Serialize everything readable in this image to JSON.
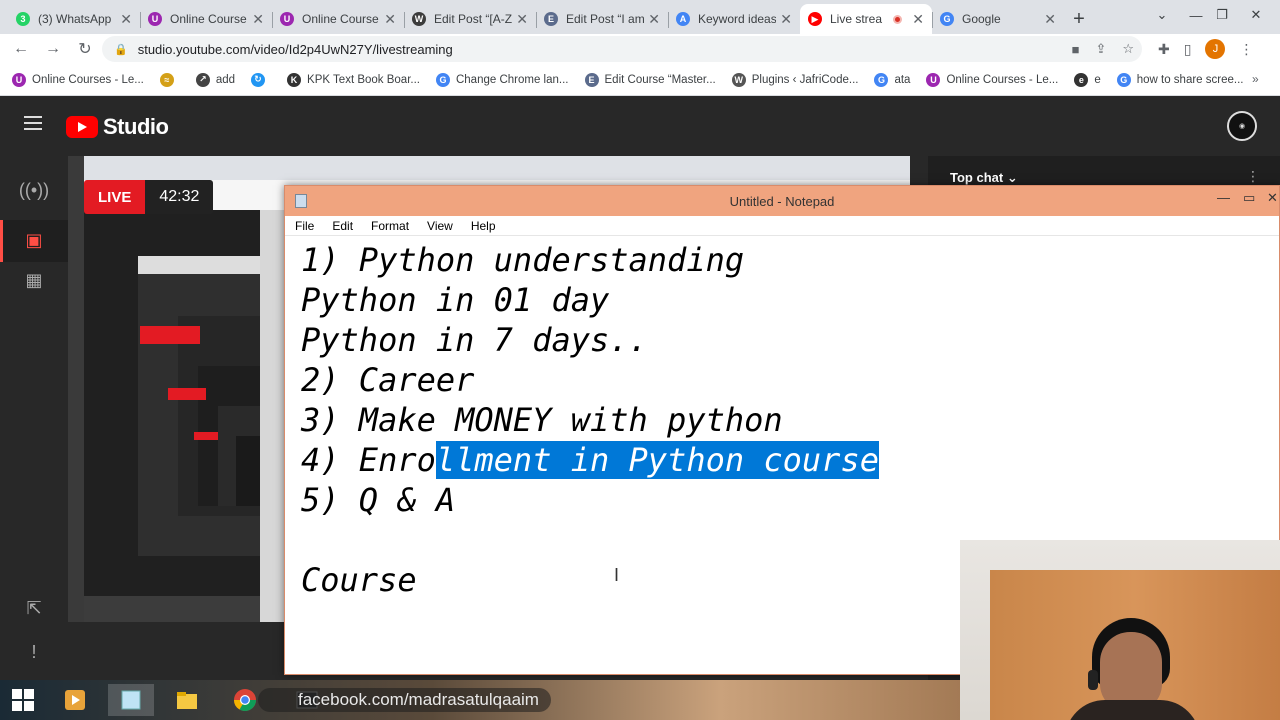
{
  "browser": {
    "tabs": [
      {
        "title": "(3) WhatsApp",
        "icon": "whatsapp-icon",
        "color": "#25d366",
        "badge": "3"
      },
      {
        "title": "Online Course",
        "icon": "course-icon",
        "color": "#9c27b0",
        "badge": "U"
      },
      {
        "title": "Online Course",
        "icon": "course-icon",
        "color": "#9c27b0",
        "badge": "U"
      },
      {
        "title": "Edit Post “[A-Z",
        "icon": "wordpress-icon",
        "color": "#3c3c3c",
        "badge": "W"
      },
      {
        "title": "Edit Post “I am",
        "icon": "edit-icon",
        "color": "#5b6b8c",
        "badge": "E"
      },
      {
        "title": "Keyword ideas",
        "icon": "google-ads-icon",
        "color": "#4285f4",
        "badge": "A"
      },
      {
        "title": "Live strea",
        "icon": "youtube-icon",
        "color": "#ff0000",
        "badge": "▶"
      },
      {
        "title": "Google",
        "icon": "google-icon",
        "color": "#4285f4",
        "badge": "G"
      }
    ],
    "active_tab_index": 6,
    "url": "studio.youtube.com/video/Id2p4UwN27Y/livestreaming",
    "profile_initial": "J",
    "bookmarks": [
      {
        "label": "Online Courses - Le...",
        "color": "#9c27b0",
        "badge": "U"
      },
      {
        "label": "",
        "color": "#d4a017",
        "badge": "≈"
      },
      {
        "label": "add",
        "color": "#444444",
        "badge": "↗"
      },
      {
        "label": "",
        "color": "#2196f3",
        "badge": "↻"
      },
      {
        "label": "KPK Text Book Boar...",
        "color": "#333333",
        "badge": "K"
      },
      {
        "label": "Change Chrome lan...",
        "color": "#4285f4",
        "badge": "G"
      },
      {
        "label": "Edit Course “Master...",
        "color": "#5b6b8c",
        "badge": "E"
      },
      {
        "label": "Plugins ‹ JafriCode...",
        "color": "#555555",
        "badge": "W"
      },
      {
        "label": "ata",
        "color": "#4285f4",
        "badge": "G"
      },
      {
        "label": "Online Courses - Le...",
        "color": "#9c27b0",
        "badge": "U"
      },
      {
        "label": "e",
        "color": "#333333",
        "badge": "e"
      },
      {
        "label": "how to share scree...",
        "color": "#4285f4",
        "badge": "G"
      }
    ]
  },
  "studio": {
    "brand": "Studio",
    "live_label": "LIVE",
    "live_timer": "42:32",
    "chat_title": "Top chat"
  },
  "notepad": {
    "window_title": "Untitled - Notepad",
    "menu": [
      "File",
      "Edit",
      "Format",
      "View",
      "Help"
    ],
    "lines": [
      "1) Python understanding",
      "Python in 01 day",
      "Python in 7 days..",
      "2) Career",
      "3) Make MONEY with python",
      "4) Enro",
      "5) Q & A",
      "",
      "Course"
    ],
    "selected_text": "llment in Python course"
  },
  "taskbar": {
    "watermark": "facebook.com/madrasatulqaaim"
  }
}
